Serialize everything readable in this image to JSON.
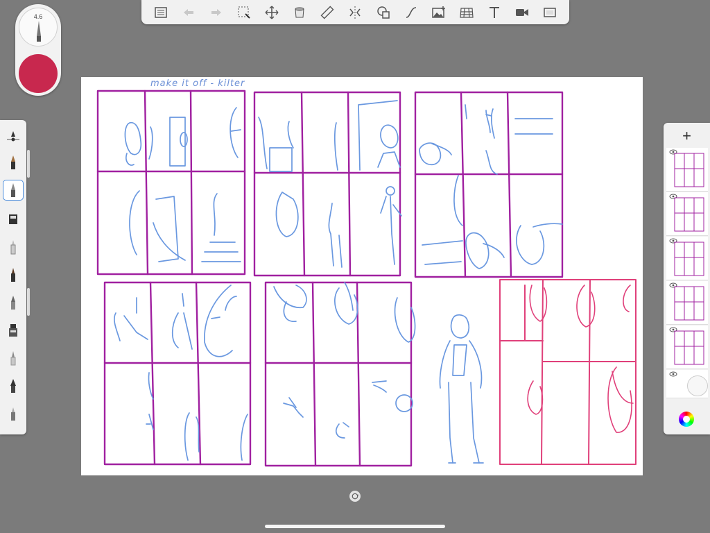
{
  "toolbar": {
    "tools": [
      "layers-icon",
      "undo-icon",
      "redo-icon",
      "selection-icon",
      "transform-icon",
      "fill-icon",
      "ruler-icon",
      "symmetry-icon",
      "shapes-icon",
      "curve-icon",
      "image-icon",
      "perspective-icon",
      "text-icon",
      "video-icon",
      "fullscreen-icon"
    ]
  },
  "brush": {
    "size_label": "4.6",
    "color": "#c8284e"
  },
  "canvas": {
    "note_text": "make it off - kilter"
  },
  "colors": {
    "purple": "#a020a0",
    "blue": "#6a98e0",
    "pink": "#e0407a"
  }
}
